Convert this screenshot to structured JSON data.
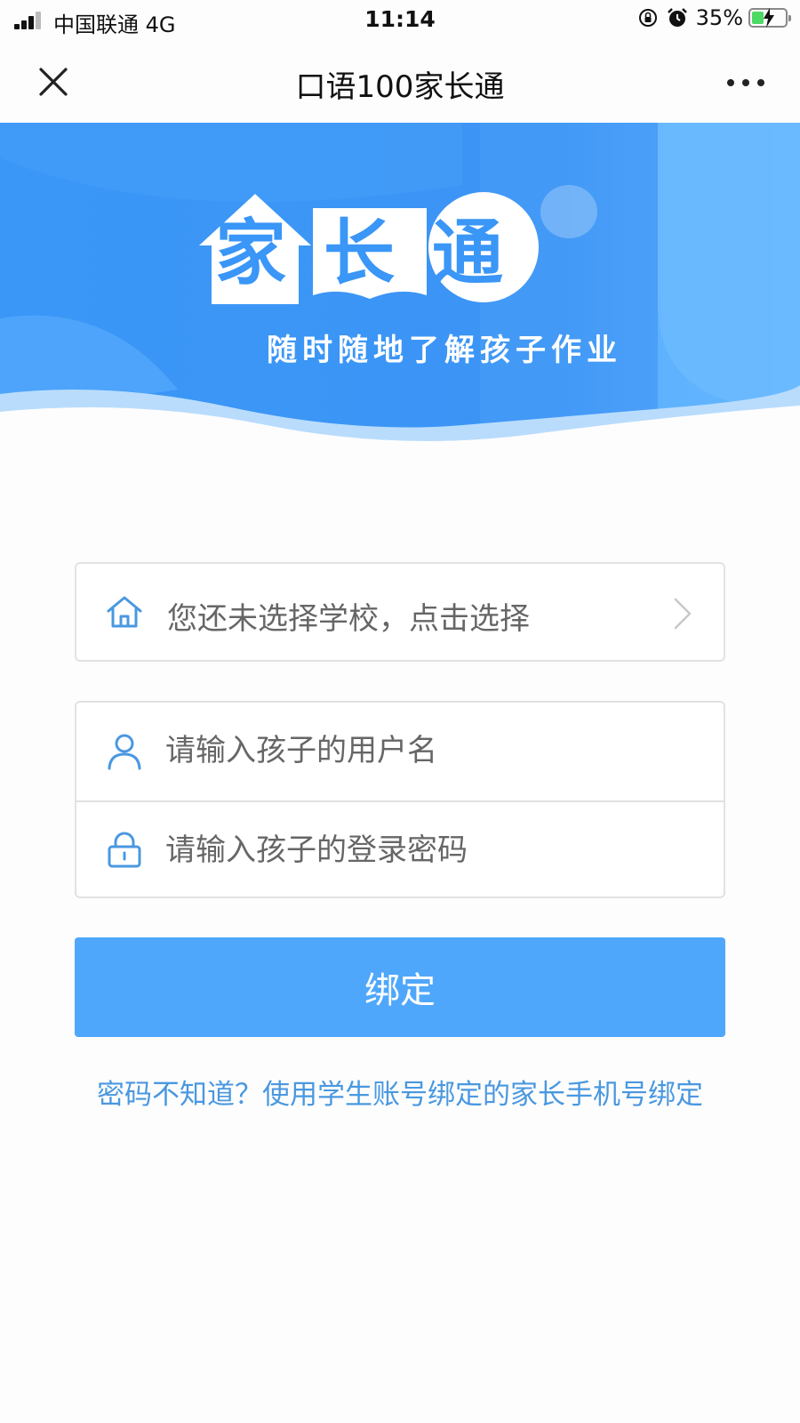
{
  "status_bar": {
    "carrier": "中国联通   4G",
    "time": "11:14",
    "battery_percent": "35%",
    "battery_level": 0.35,
    "icons": [
      "signal-icon",
      "rotation-lock-icon",
      "alarm-icon",
      "battery-charging-icon"
    ]
  },
  "nav": {
    "title": "口语100家长通",
    "close_icon": "close-icon",
    "more_icon": "more-icon"
  },
  "banner": {
    "logo_text": "家长通",
    "slogan": "随时随地了解孩子作业",
    "colors": {
      "primary": "#3a96f7",
      "light": "#6dbbff"
    }
  },
  "form": {
    "school": {
      "placeholder": "您还未选择学校，点击选择",
      "icon": "home-icon"
    },
    "username": {
      "placeholder": "请输入孩子的用户名",
      "icon": "user-icon"
    },
    "password": {
      "placeholder": "请输入孩子的登录密码",
      "icon": "lock-icon"
    },
    "submit_label": "绑定",
    "help_link": "密码不知道？使用学生账号绑定的家长手机号绑定"
  },
  "colors": {
    "button": "#4fa7fb",
    "link": "#4a98e0",
    "icon": "#4a98e0"
  }
}
